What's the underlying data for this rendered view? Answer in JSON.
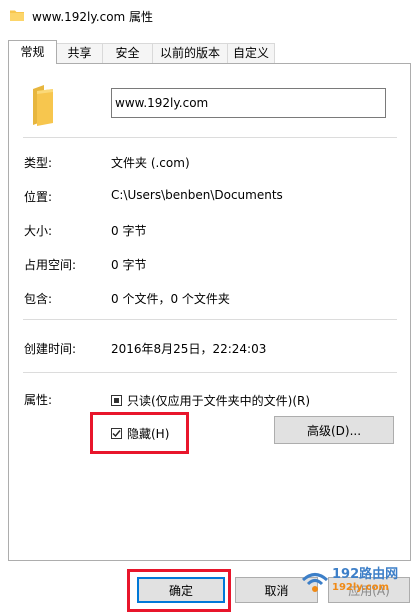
{
  "window": {
    "title": "www.192ly.com 属性"
  },
  "tabs": [
    {
      "label": "常规",
      "active": true
    },
    {
      "label": "共享"
    },
    {
      "label": "安全"
    },
    {
      "label": "以前的版本"
    },
    {
      "label": "自定义"
    }
  ],
  "general": {
    "name_value": "www.192ly.com",
    "type": {
      "label": "类型:",
      "value": "文件夹 (.com)"
    },
    "location": {
      "label": "位置:",
      "value": "C:\\Users\\benben\\Documents"
    },
    "size": {
      "label": "大小:",
      "value": "0 字节"
    },
    "size_on_disk": {
      "label": "占用空间:",
      "value": "0 字节"
    },
    "contains": {
      "label": "包含:",
      "value": "0 个文件，0 个文件夹"
    },
    "created": {
      "label": "创建时间:",
      "value": "2016年8月25日，22:24:03"
    },
    "attributes": {
      "label": "属性:",
      "readonly": {
        "label": "只读(仅应用于文件夹中的文件)(R)",
        "state": "indeterminate"
      },
      "hidden": {
        "label": "隐藏(H)",
        "checked": true
      },
      "advanced_button": "高级(D)..."
    }
  },
  "footer": {
    "ok": "确定",
    "cancel": "取消",
    "apply": "应用(A)"
  },
  "watermark": {
    "line1": "192路由网",
    "line2": "192ly.com"
  },
  "colors": {
    "highlight_box": "#e8152b",
    "folder": "#f7c64e",
    "accent": "#0078d7"
  }
}
